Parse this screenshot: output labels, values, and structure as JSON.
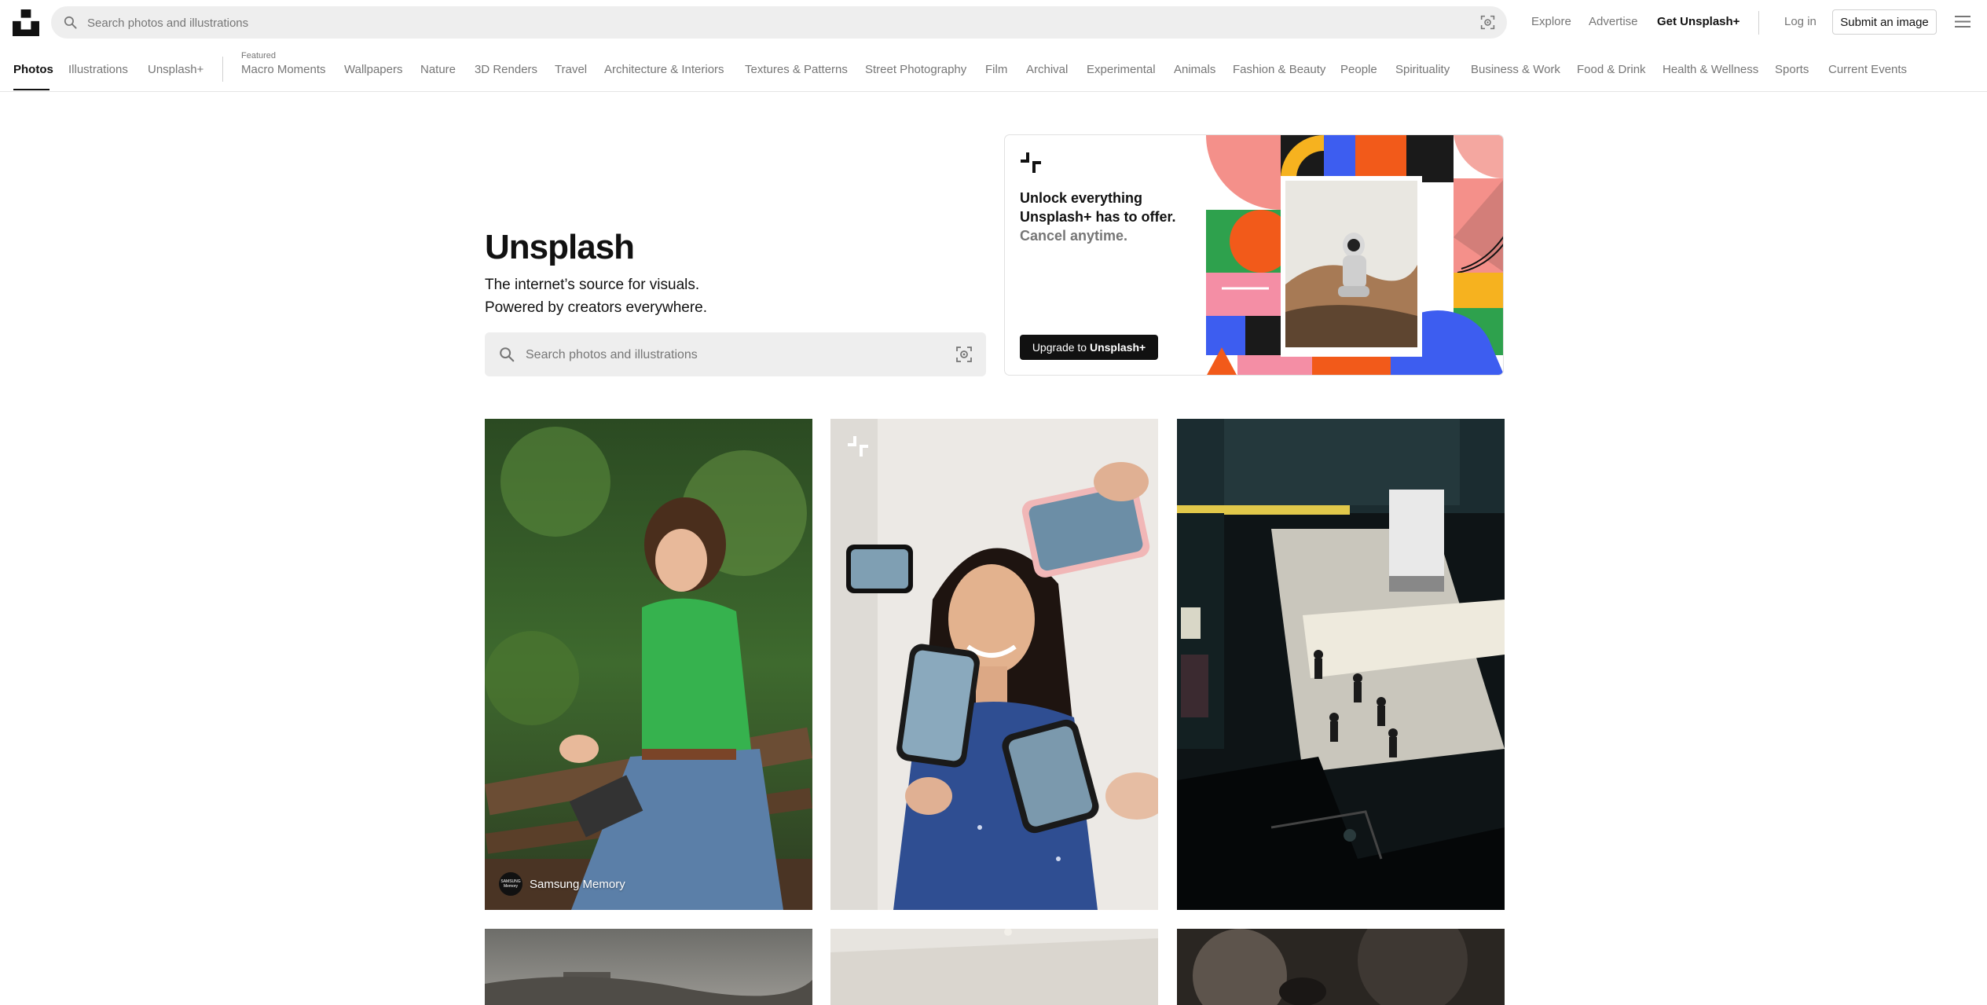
{
  "header": {
    "search_placeholder": "Search photos and illustrations",
    "links": {
      "explore": "Explore",
      "advertise": "Advertise",
      "get_plus": "Get Unsplash+",
      "login": "Log in"
    },
    "submit_label": "Submit an image"
  },
  "catnav": {
    "tabs": [
      "Photos",
      "Illustrations",
      "Unsplash+"
    ],
    "featured_label": "Featured",
    "topics": [
      "Macro Moments",
      "Wallpapers",
      "Nature",
      "3D Renders",
      "Travel",
      "Architecture & Interiors",
      "Textures & Patterns",
      "Street Photography",
      "Film",
      "Archival",
      "Experimental",
      "Animals",
      "Fashion & Beauty",
      "People",
      "Spirituality",
      "Business & Work",
      "Food & Drink",
      "Health & Wellness",
      "Sports",
      "Current Events"
    ]
  },
  "hero": {
    "title": "Unsplash",
    "subtitle_line1": "The internet’s source for visuals.",
    "subtitle_line2": "Powered by creators everywhere.",
    "search_placeholder": "Search photos and illustrations"
  },
  "promo": {
    "line1": "Unlock everything",
    "line2": "Unsplash+ has to offer.",
    "line3": "Cancel anytime.",
    "button_prefix": "Upgrade to ",
    "button_bold": "Unsplash+"
  },
  "photos": {
    "first_author": "Samsung Memory",
    "first_author_avatar": "SAMSUNG Memory"
  },
  "colors": {
    "text": "#111111",
    "muted": "#767676",
    "search_bg": "#eeeeee",
    "border": "#d1d1d1"
  }
}
